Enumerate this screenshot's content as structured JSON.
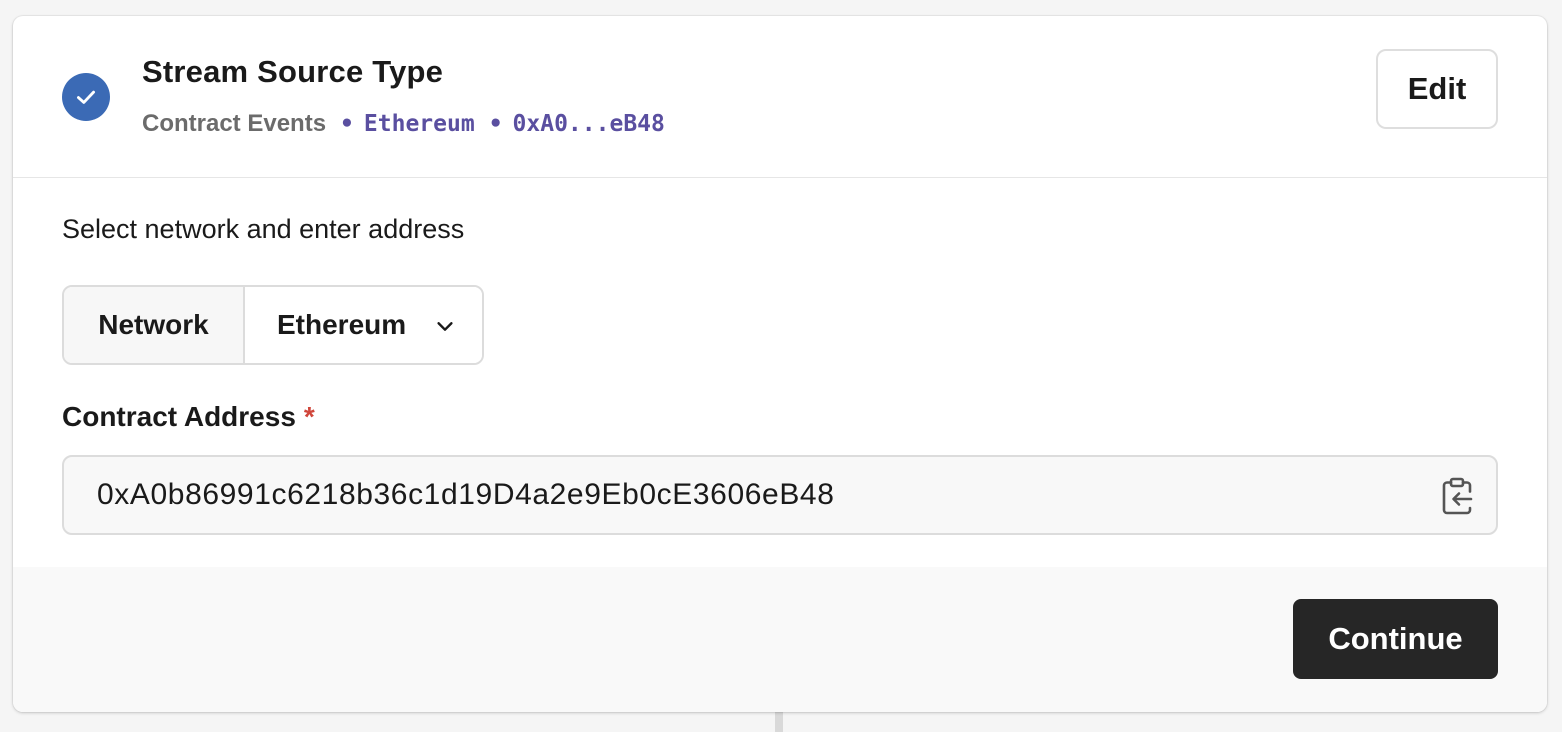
{
  "step": {
    "title": "Stream Source Type",
    "summary_type": "Contract Events",
    "separator": "•",
    "summary_network": "Ethereum",
    "summary_address": "0xA0...eB48",
    "edit_label": "Edit",
    "status_icon": "check-icon"
  },
  "form": {
    "section_label": "Select network and enter address",
    "network_label": "Network",
    "network_value": "Ethereum",
    "address_label": "Contract Address",
    "required_mark": "*",
    "address_value": "0xA0b86991c6218b36c1d19D4a2e9Eb0cE3606eB48"
  },
  "footer": {
    "continue_label": "Continue"
  },
  "colors": {
    "accent": "#3b6ab5",
    "mono_text": "#5a4fa0",
    "required": "#d0463b",
    "primary_button": "#262626"
  }
}
